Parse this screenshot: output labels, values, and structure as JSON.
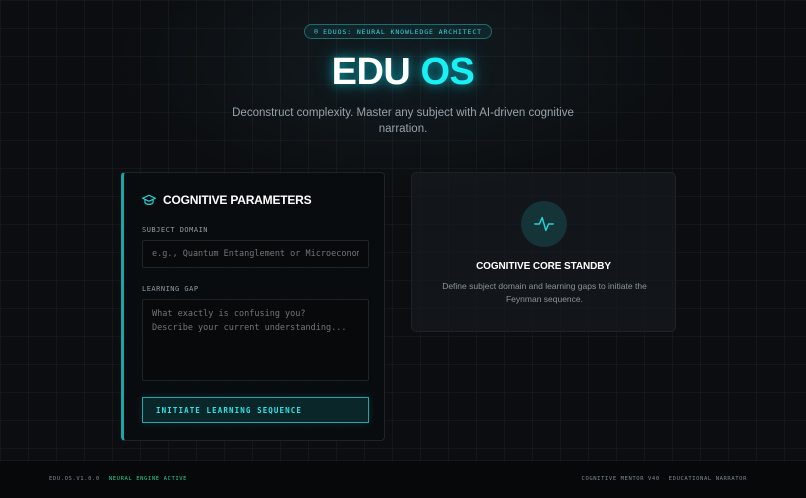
{
  "badge": {
    "icon": "target-icon",
    "glyph": "◎",
    "text": "EDUOS: NEURAL KNOWLEDGE ARCHITECT"
  },
  "hero": {
    "title_main": "EDU",
    "title_accent": "OS",
    "subtitle": "Deconstruct complexity. Master any subject with AI-driven cognitive narration."
  },
  "params_panel": {
    "icon": "graduation-cap-icon",
    "title": "COGNITIVE PARAMETERS",
    "subject_label": "SUBJECT DOMAIN",
    "subject_placeholder": "e.g., Quantum Entanglement or Microeconomics",
    "subject_value": "",
    "gap_label": "LEARNING GAP",
    "gap_placeholder": "What exactly is confusing you?\nDescribe your current understanding...",
    "gap_value": "",
    "button_label": "INITIATE LEARNING SEQUENCE"
  },
  "standby_panel": {
    "icon": "pulse-icon",
    "title": "COGNITIVE CORE STANDBY",
    "description": "Define subject domain and learning gaps to initiate the Feynman sequence."
  },
  "footer": {
    "version": "EDU.OS.V1.0.0",
    "status": "NEURAL ENGINE ACTIVE",
    "status_color": "#1fcf8a",
    "links": [
      "COGNITIVE MENTOR V40",
      "EDUCATIONAL NARRATOR"
    ]
  },
  "colors": {
    "accent": "#19f0f5",
    "background": "#0b0d10"
  }
}
